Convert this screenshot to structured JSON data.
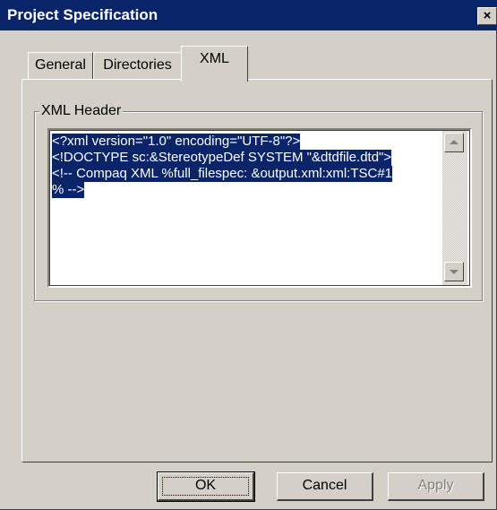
{
  "window": {
    "title": "Project Specification",
    "close_symbol": "×",
    "colors": {
      "titlebar": "#0a246a",
      "face": "#d4d0c8",
      "selection": "#0a246a"
    }
  },
  "tabs": [
    {
      "label": "General",
      "active": false
    },
    {
      "label": "Directories",
      "active": false
    },
    {
      "label": "XML",
      "active": true
    }
  ],
  "xml_header": {
    "group_label": "XML Header",
    "lines": [
      "<?xml version=\"1.0\" encoding=\"UTF-8\"?>",
      "<!DOCTYPE sc:&StereotypeDef SYSTEM \"&dtdfile.dtd\">",
      "<!-- Compaq XML %full_filespec: &output.xml:xml:TSC#1",
      "% -->"
    ]
  },
  "buttons": {
    "ok": "OK",
    "cancel": "Cancel",
    "apply": "Apply"
  }
}
